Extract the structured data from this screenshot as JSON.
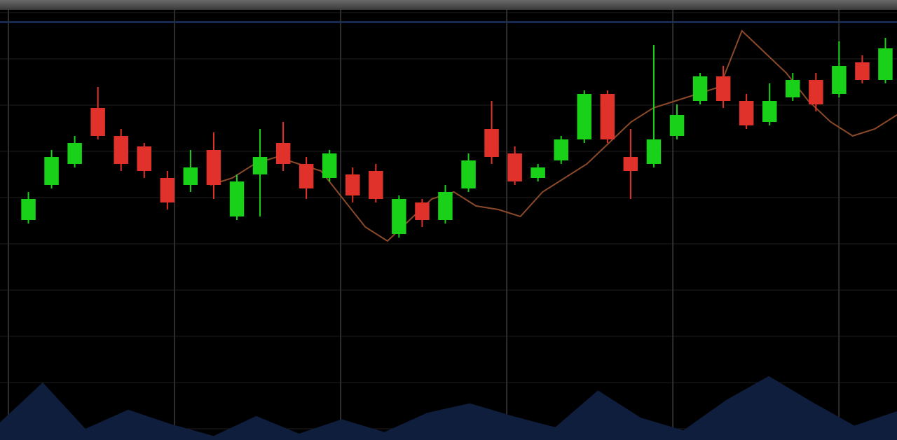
{
  "window": {
    "title_left": "",
    "title_right": ""
  },
  "colors": {
    "background": "#000000",
    "up": "#19d119",
    "down": "#e0322a",
    "overlay_line": "#8a4a2a",
    "volume": "#0f1e3d",
    "grid": "#1e1e1e",
    "divider": "#2e2e2e",
    "accent_bar": "#162a55"
  },
  "chart_data": {
    "type": "candlestick",
    "grid": true,
    "ylim": [
      0,
      100
    ],
    "candles": [
      {
        "x": 0,
        "o": 44,
        "c": 50,
        "h": 52,
        "l": 43
      },
      {
        "x": 1,
        "o": 54,
        "c": 62,
        "h": 64,
        "l": 53
      },
      {
        "x": 2,
        "o": 60,
        "c": 66,
        "h": 68,
        "l": 59
      },
      {
        "x": 3,
        "o": 76,
        "c": 68,
        "h": 82,
        "l": 67
      },
      {
        "x": 4,
        "o": 68,
        "c": 60,
        "h": 70,
        "l": 58
      },
      {
        "x": 5,
        "o": 65,
        "c": 58,
        "h": 66,
        "l": 56
      },
      {
        "x": 6,
        "o": 56,
        "c": 49,
        "h": 58,
        "l": 47
      },
      {
        "x": 7,
        "o": 54,
        "c": 59,
        "h": 64,
        "l": 52
      },
      {
        "x": 8,
        "o": 64,
        "c": 54,
        "h": 69,
        "l": 50
      },
      {
        "x": 9,
        "o": 45,
        "c": 55,
        "h": 57,
        "l": 44
      },
      {
        "x": 10,
        "o": 57,
        "c": 62,
        "h": 70,
        "l": 45
      },
      {
        "x": 11,
        "o": 66,
        "c": 60,
        "h": 72,
        "l": 58
      },
      {
        "x": 12,
        "o": 60,
        "c": 53,
        "h": 62,
        "l": 50
      },
      {
        "x": 13,
        "o": 56,
        "c": 63,
        "h": 64,
        "l": 55
      },
      {
        "x": 14,
        "o": 57,
        "c": 51,
        "h": 59,
        "l": 49
      },
      {
        "x": 15,
        "o": 58,
        "c": 50,
        "h": 60,
        "l": 49
      },
      {
        "x": 16,
        "o": 40,
        "c": 50,
        "h": 51,
        "l": 39
      },
      {
        "x": 17,
        "o": 49,
        "c": 44,
        "h": 50,
        "l": 42
      },
      {
        "x": 18,
        "o": 44,
        "c": 52,
        "h": 54,
        "l": 43
      },
      {
        "x": 19,
        "o": 53,
        "c": 61,
        "h": 63,
        "l": 52
      },
      {
        "x": 20,
        "o": 70,
        "c": 62,
        "h": 78,
        "l": 60
      },
      {
        "x": 21,
        "o": 63,
        "c": 55,
        "h": 65,
        "l": 54
      },
      {
        "x": 22,
        "o": 56,
        "c": 59,
        "h": 60,
        "l": 55
      },
      {
        "x": 23,
        "o": 61,
        "c": 67,
        "h": 68,
        "l": 60
      },
      {
        "x": 24,
        "o": 67,
        "c": 80,
        "h": 81,
        "l": 66
      },
      {
        "x": 25,
        "o": 80,
        "c": 67,
        "h": 81,
        "l": 66
      },
      {
        "x": 26,
        "o": 62,
        "c": 58,
        "h": 70,
        "l": 50
      },
      {
        "x": 27,
        "o": 60,
        "c": 67,
        "h": 94,
        "l": 59
      },
      {
        "x": 28,
        "o": 68,
        "c": 74,
        "h": 77,
        "l": 67
      },
      {
        "x": 29,
        "o": 78,
        "c": 85,
        "h": 86,
        "l": 77
      },
      {
        "x": 30,
        "o": 85,
        "c": 78,
        "h": 88,
        "l": 76
      },
      {
        "x": 31,
        "o": 78,
        "c": 71,
        "h": 80,
        "l": 70
      },
      {
        "x": 32,
        "o": 72,
        "c": 78,
        "h": 83,
        "l": 71
      },
      {
        "x": 33,
        "o": 79,
        "c": 84,
        "h": 86,
        "l": 78
      },
      {
        "x": 34,
        "o": 84,
        "c": 77,
        "h": 86,
        "l": 75
      },
      {
        "x": 35,
        "o": 80,
        "c": 88,
        "h": 95,
        "l": 79
      },
      {
        "x": 36,
        "o": 89,
        "c": 84,
        "h": 91,
        "l": 83
      },
      {
        "x": 37,
        "o": 84,
        "c": 93,
        "h": 96,
        "l": 83
      }
    ],
    "overlay": [
      54,
      56,
      60,
      62,
      60,
      58,
      50,
      42,
      38,
      44,
      50,
      52,
      48,
      47,
      45,
      52,
      56,
      60,
      66,
      72,
      76,
      78,
      80,
      82,
      98,
      92,
      86,
      78,
      72,
      68,
      70,
      74
    ],
    "volume": [
      22,
      72,
      14,
      38,
      20,
      5,
      30,
      8,
      26,
      10,
      34,
      46,
      30,
      16,
      62,
      28,
      12,
      50,
      80,
      48,
      18,
      36
    ]
  }
}
